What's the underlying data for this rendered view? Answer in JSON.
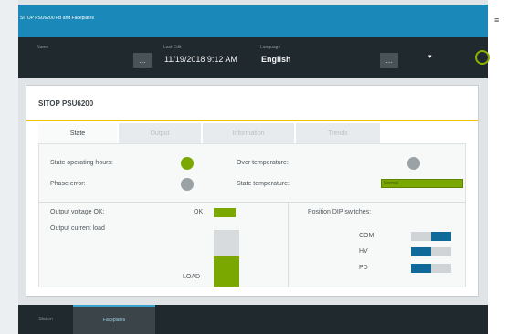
{
  "window": {
    "title": "SITOP PSU6200 FB and Faceplates"
  },
  "toolbar": {
    "field1_label": "Name",
    "field2_label": "Last Edit",
    "datetime": "11/19/2018 9:12 AM",
    "field3_label": "Language",
    "language": "English",
    "more_symbol": "...",
    "menu_symbol": "▾"
  },
  "panel": {
    "title": "SITOP PSU6200",
    "tabs": [
      {
        "label": "State",
        "active": true
      },
      {
        "label": "Output",
        "active": false
      },
      {
        "label": "Information",
        "active": false
      },
      {
        "label": "Trends",
        "active": false
      }
    ]
  },
  "state": {
    "operating_hours_label": "State operating hours:",
    "operating_hours_status": "green",
    "phase_error_label": "Phase error:",
    "phase_error_status": "grey",
    "over_temp_label": "Over temperature:",
    "over_temp_status": "grey",
    "state_temp_label": "State temperature:",
    "state_temp_value": "Normal"
  },
  "output": {
    "voltage_ok_label": "Output voltage OK:",
    "ok_label": "OK",
    "current_load_label": "Output current load",
    "load_label": "LOAD",
    "load_fraction": 0.5
  },
  "dip_switches": {
    "label": "Position DIP switches:",
    "items": [
      {
        "name": "COM",
        "position": "right"
      },
      {
        "name": "HV",
        "position": "left"
      },
      {
        "name": "PD",
        "position": "left"
      }
    ]
  },
  "bottom_tabs": [
    {
      "label": "Station",
      "active": false
    },
    {
      "label": "Faceplates",
      "active": true
    }
  ],
  "colors": {
    "titlebar": "#1a88b8",
    "toolbar": "#20292d",
    "accent_line": "#f0c400",
    "status_green": "#7ba800",
    "status_grey": "#9aa2a6",
    "dip_on": "#0f6a9a",
    "dip_off": "#d0d4d6"
  }
}
